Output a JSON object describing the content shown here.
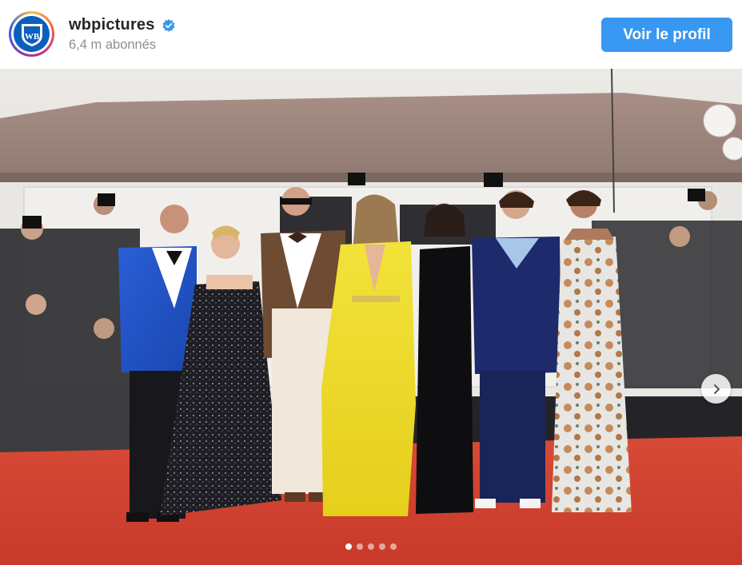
{
  "account": {
    "username": "wbpictures",
    "followers": "6,4 m abonnés",
    "logo_text": "WB"
  },
  "actions": {
    "view_profile_label": "Voir le profil"
  },
  "carousel": {
    "slide_count": 5,
    "active_index": 0
  },
  "colors": {
    "accent": "#3897f0",
    "verified": "#3897f0",
    "carpet": "#d9402f"
  },
  "icons": {
    "verified": "verified-badge-icon",
    "next": "chevron-right-icon",
    "logo": "wb-shield-logo"
  }
}
